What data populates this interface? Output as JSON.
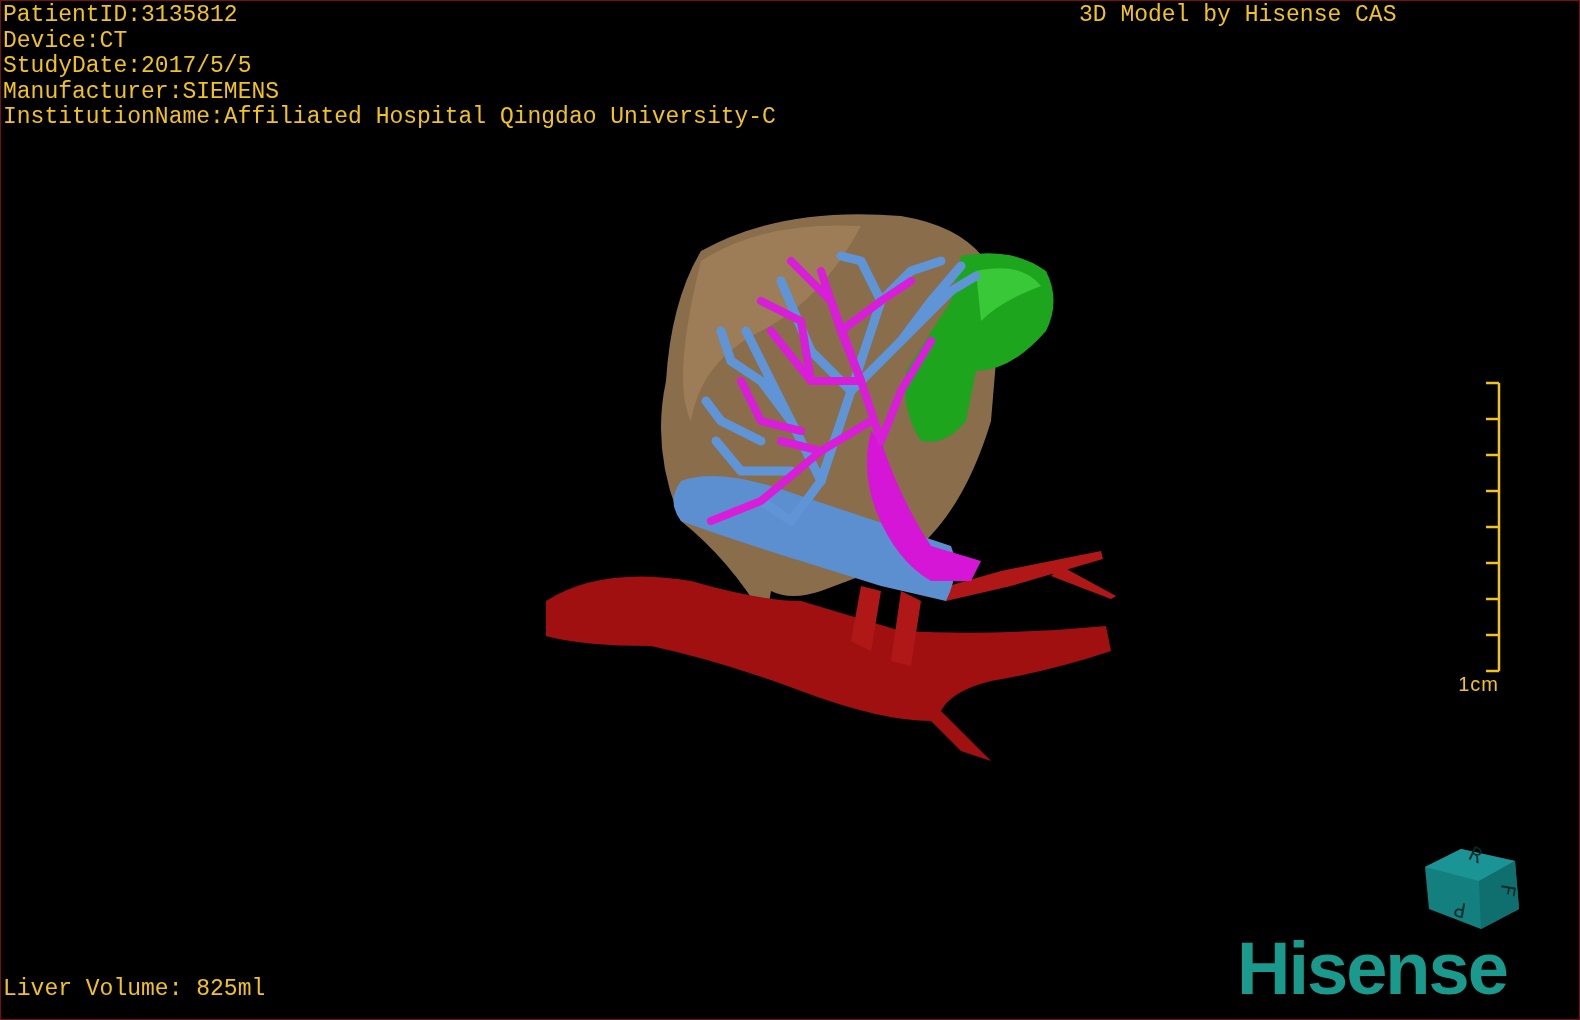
{
  "patient_info": [
    "PatientID:3135812",
    "Device:CT",
    "StudyDate:2017/5/5",
    "Manufacturer:SIEMENS",
    "InstitutionName:Affiliated Hospital Qingdao University-C"
  ],
  "title": "3D Model by Hisense CAS",
  "scale_bar": {
    "label": "1cm"
  },
  "orientation_cube": {
    "faces": [
      "R",
      "F",
      "P"
    ]
  },
  "liver_volume": "Liver Volume: 825ml",
  "logo": "Hisense"
}
